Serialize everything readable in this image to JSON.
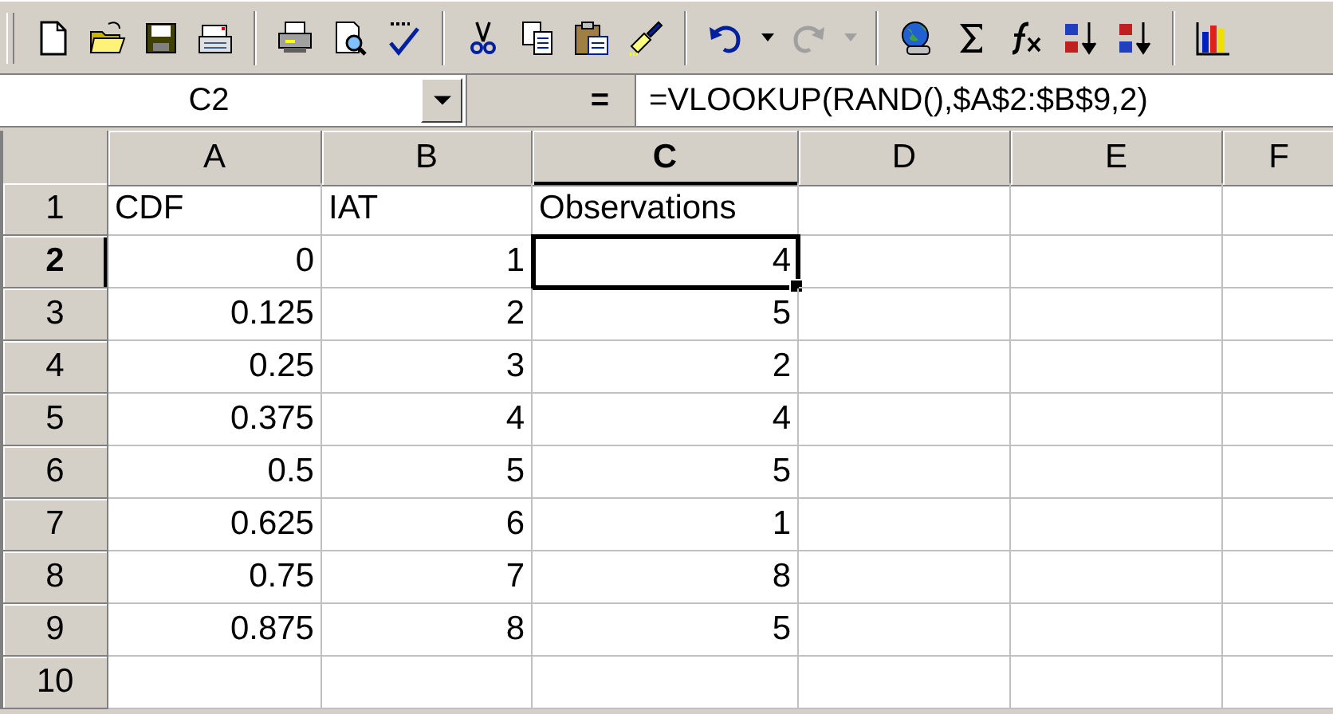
{
  "toolbar": {
    "undo": {
      "disabled": false
    },
    "redo": {
      "disabled": true
    }
  },
  "formula_bar": {
    "name_box": "C2",
    "equals_button": "=",
    "formula": "=VLOOKUP(RAND(),$A$2:$B$9,2)"
  },
  "columns": [
    {
      "label": "A",
      "selected": false
    },
    {
      "label": "B",
      "selected": false
    },
    {
      "label": "C",
      "selected": true
    },
    {
      "label": "D",
      "selected": false
    },
    {
      "label": "E",
      "selected": false
    },
    {
      "label": "F",
      "selected": false
    }
  ],
  "rows": [
    {
      "label": "1",
      "selected": false,
      "cells": [
        {
          "value": "CDF",
          "kind": "text",
          "selected": false
        },
        {
          "value": "IAT",
          "kind": "text",
          "selected": false
        },
        {
          "value": "Observations",
          "kind": "text",
          "selected": false
        }
      ]
    },
    {
      "label": "2",
      "selected": true,
      "cells": [
        {
          "value": "0",
          "kind": "number",
          "selected": false
        },
        {
          "value": "1",
          "kind": "number",
          "selected": false
        },
        {
          "value": "4",
          "kind": "number",
          "selected": true
        }
      ]
    },
    {
      "label": "3",
      "selected": false,
      "cells": [
        {
          "value": "0.125",
          "kind": "number",
          "selected": false
        },
        {
          "value": "2",
          "kind": "number",
          "selected": false
        },
        {
          "value": "5",
          "kind": "number",
          "selected": false
        }
      ]
    },
    {
      "label": "4",
      "selected": false,
      "cells": [
        {
          "value": "0.25",
          "kind": "number",
          "selected": false
        },
        {
          "value": "3",
          "kind": "number",
          "selected": false
        },
        {
          "value": "2",
          "kind": "number",
          "selected": false
        }
      ]
    },
    {
      "label": "5",
      "selected": false,
      "cells": [
        {
          "value": "0.375",
          "kind": "number",
          "selected": false
        },
        {
          "value": "4",
          "kind": "number",
          "selected": false
        },
        {
          "value": "4",
          "kind": "number",
          "selected": false
        }
      ]
    },
    {
      "label": "6",
      "selected": false,
      "cells": [
        {
          "value": "0.5",
          "kind": "number",
          "selected": false
        },
        {
          "value": "5",
          "kind": "number",
          "selected": false
        },
        {
          "value": "5",
          "kind": "number",
          "selected": false
        }
      ]
    },
    {
      "label": "7",
      "selected": false,
      "cells": [
        {
          "value": "0.625",
          "kind": "number",
          "selected": false
        },
        {
          "value": "6",
          "kind": "number",
          "selected": false
        },
        {
          "value": "1",
          "kind": "number",
          "selected": false
        }
      ]
    },
    {
      "label": "8",
      "selected": false,
      "cells": [
        {
          "value": "0.75",
          "kind": "number",
          "selected": false
        },
        {
          "value": "7",
          "kind": "number",
          "selected": false
        },
        {
          "value": "8",
          "kind": "number",
          "selected": false
        }
      ]
    },
    {
      "label": "9",
      "selected": false,
      "cells": [
        {
          "value": "0.875",
          "kind": "number",
          "selected": false
        },
        {
          "value": "8",
          "kind": "number",
          "selected": false
        },
        {
          "value": "5",
          "kind": "number",
          "selected": false
        }
      ]
    },
    {
      "label": "10",
      "selected": false,
      "cells": []
    }
  ]
}
